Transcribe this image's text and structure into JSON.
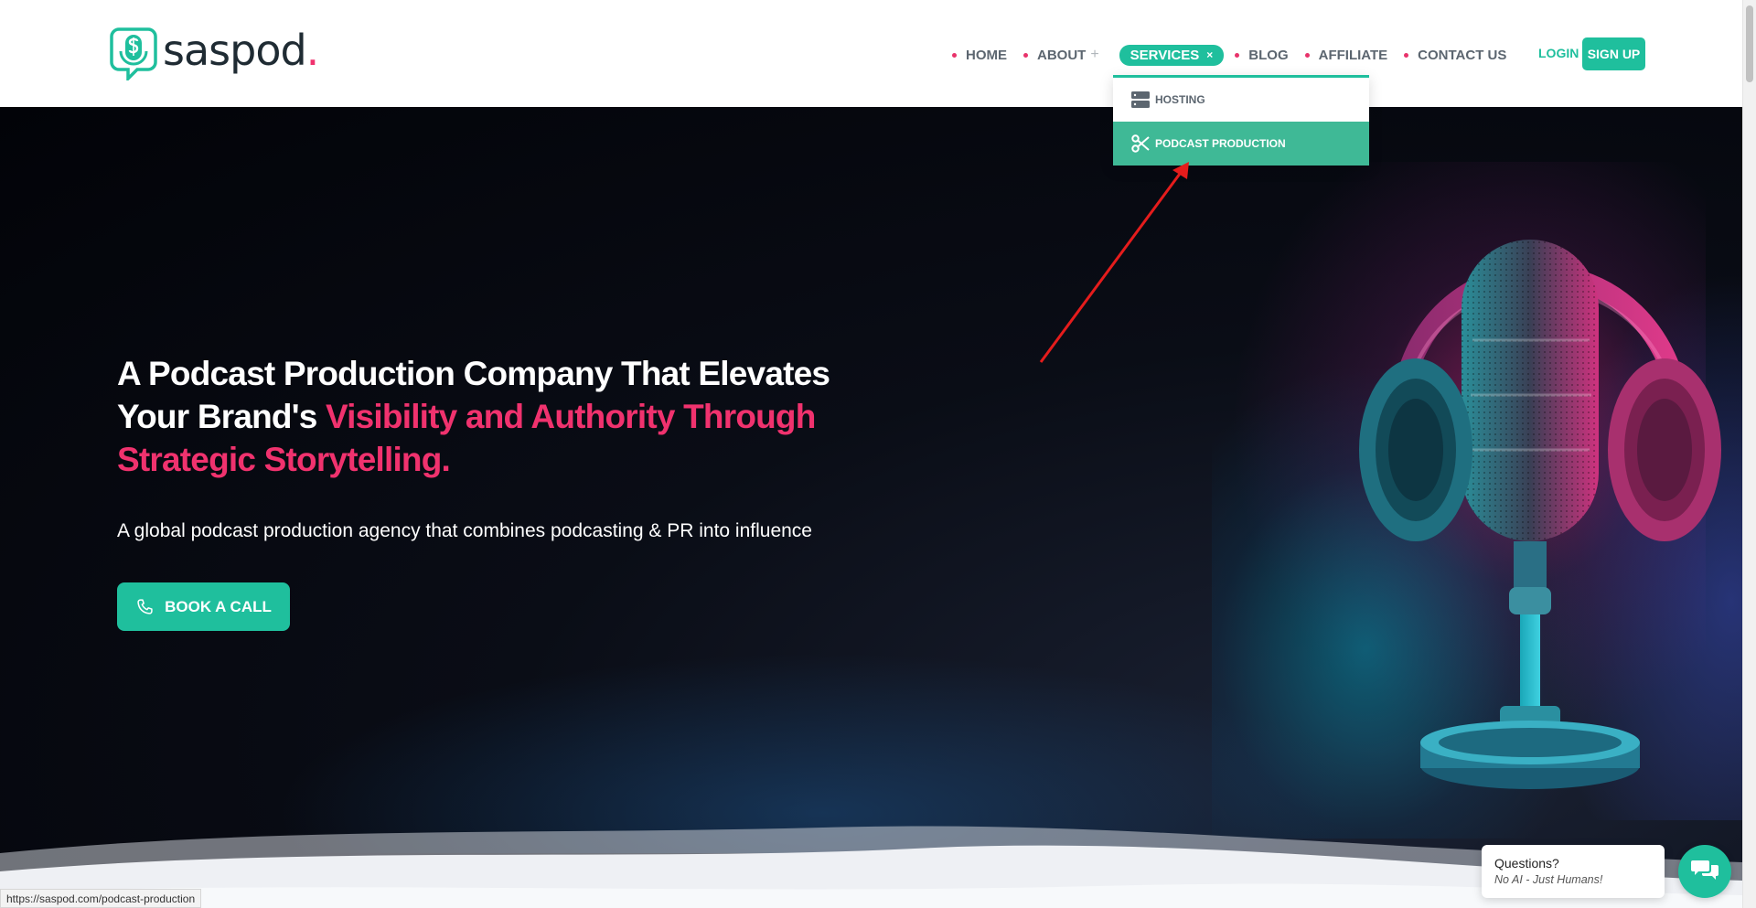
{
  "brand": {
    "name": "saspod",
    "dot": ".",
    "accent_color": "#1fbf9d",
    "pink_color": "#f0326e"
  },
  "nav": {
    "items": [
      {
        "label": "HOME"
      },
      {
        "label": "ABOUT",
        "suffix": "+"
      },
      {
        "label": "SERVICES",
        "suffix": "×",
        "active": true
      },
      {
        "label": "BLOG"
      },
      {
        "label": "AFFILIATE"
      },
      {
        "label": "CONTACT US"
      }
    ],
    "login": "LOGIN",
    "signup": "SIGN UP"
  },
  "services_menu": {
    "items": [
      {
        "label": "HOSTING",
        "icon": "server-icon"
      },
      {
        "label": "PODCAST PRODUCTION",
        "icon": "scissors-icon",
        "hovered": true
      }
    ]
  },
  "hero": {
    "title_white": "A Podcast Production Company That Elevates Your Brand's ",
    "title_pink": "Visibility and Authority Through Strategic Storytelling.",
    "subtitle": "A global podcast production agency that combines podcasting & PR into influence",
    "cta": "BOOK A CALL"
  },
  "status_bar": {
    "url": "https://saspod.com/podcast-production"
  },
  "chat": {
    "question": "Questions?",
    "answer": "No AI - Just Humans!"
  }
}
